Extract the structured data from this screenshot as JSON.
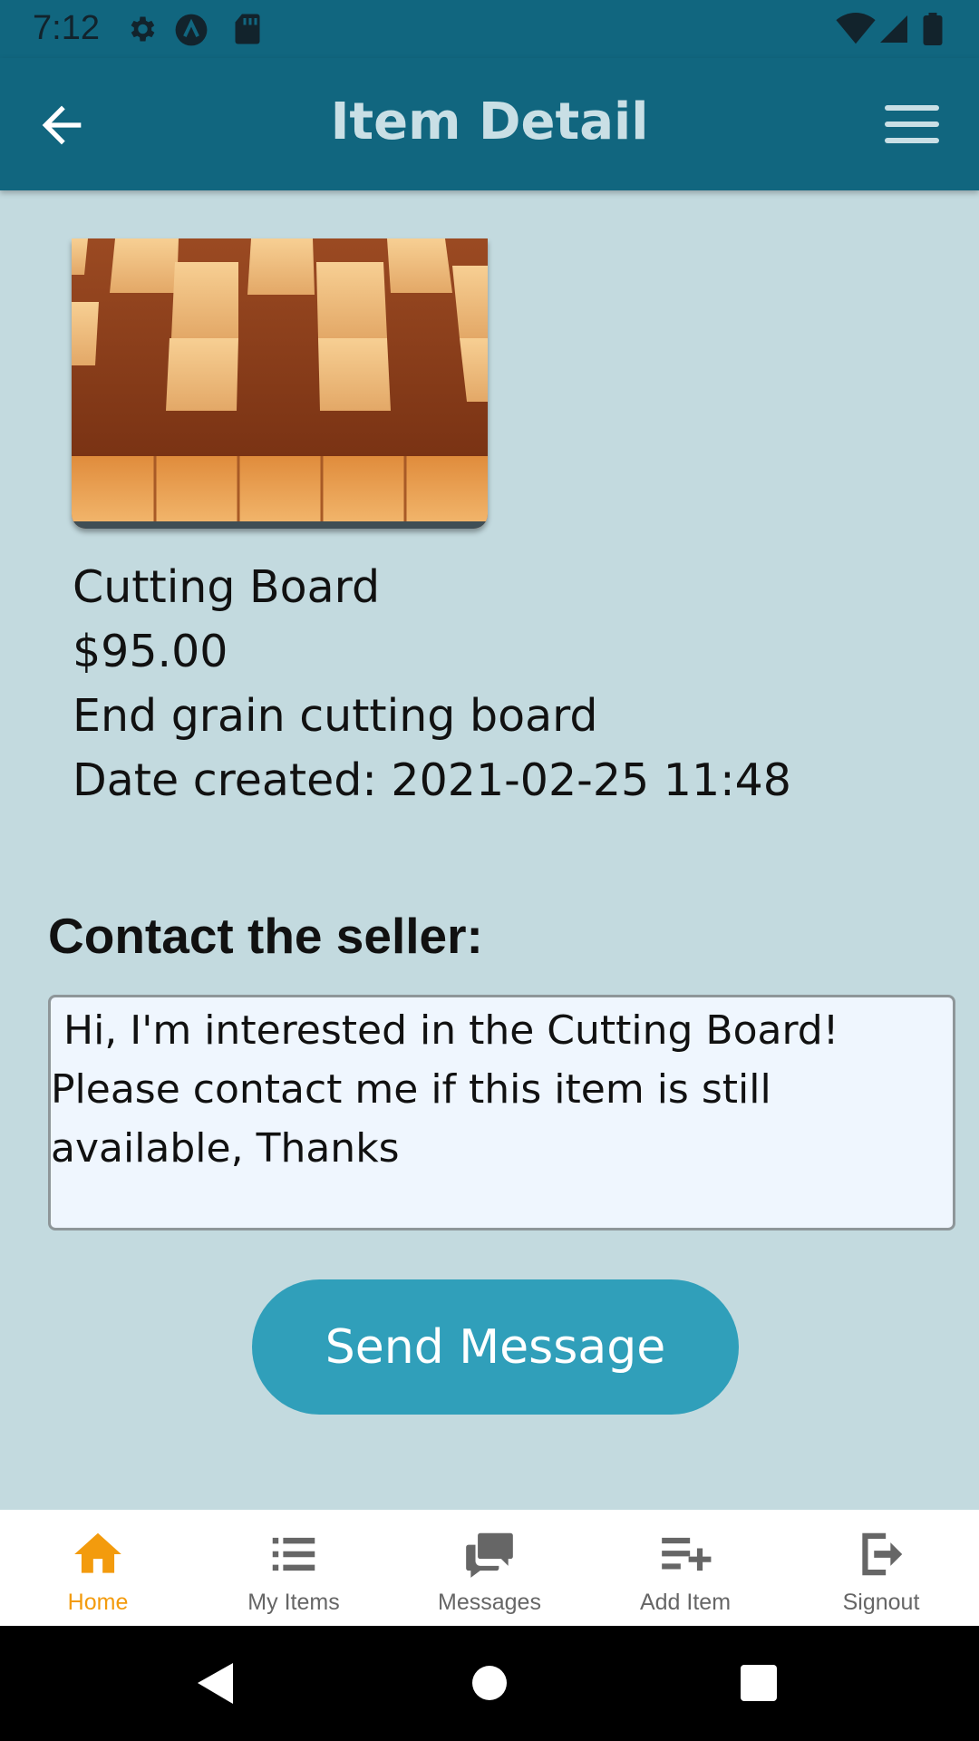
{
  "status_bar": {
    "time": "7:12",
    "icons": [
      "gear-icon",
      "app-a-icon",
      "sd-card-icon",
      "wifi-icon",
      "signal-icon",
      "battery-icon"
    ]
  },
  "app_bar": {
    "title": "Item Detail",
    "back_icon": "arrow-left-icon",
    "menu_icon": "hamburger-menu-icon"
  },
  "item": {
    "image": "cutting-board-photo",
    "name": "Cutting Board",
    "price": "$95.00",
    "description": "End grain cutting board",
    "date_created": "Date created: 2021-02-25 11:48"
  },
  "contact": {
    "heading": "Contact the seller:",
    "message": " Hi, I'm interested in the Cutting Board!\nPlease contact me if this item is still\navailable, Thanks",
    "send_label": "Send Message"
  },
  "bottom_nav": {
    "active": "Home",
    "items": [
      {
        "label": "Home",
        "icon": "home-icon"
      },
      {
        "label": "My Items",
        "icon": "list-icon"
      },
      {
        "label": "Messages",
        "icon": "chat-bubbles-icon"
      },
      {
        "label": "Add Item",
        "icon": "playlist-add-icon"
      },
      {
        "label": "Signout",
        "icon": "logout-icon"
      }
    ]
  },
  "colors": {
    "app_bar": "#11667f",
    "background": "#c3dadf",
    "button": "#309fba",
    "active_nav": "#f39b0d",
    "title_text": "#c9dfe5"
  }
}
